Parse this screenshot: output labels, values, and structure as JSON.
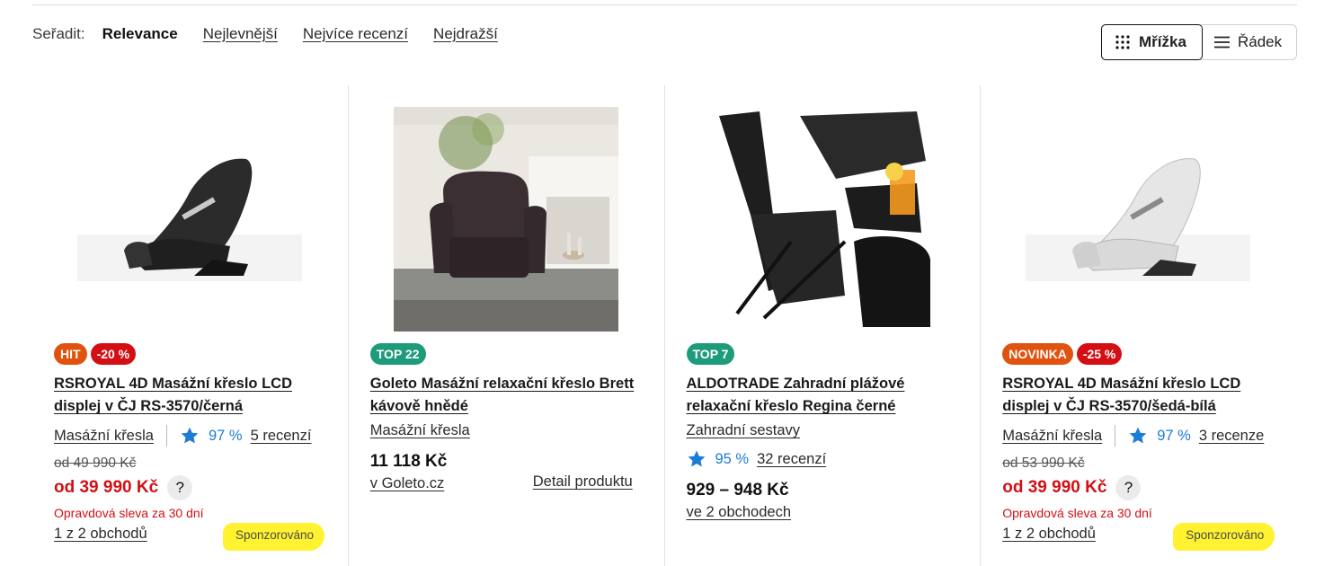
{
  "sort": {
    "label": "Seřadit:",
    "options": [
      "Relevance",
      "Nejlevnější",
      "Nejvíce recenzí",
      "Nejdražší"
    ],
    "active_index": 0
  },
  "view": {
    "grid_label": "Mřížka",
    "row_label": "Řádek",
    "active": "grid"
  },
  "products": [
    {
      "badges": [
        "HIT",
        "-20 %"
      ],
      "title": "RSROYAL 4D Masážní křeslo LCD displej v ČJ RS-3570/černá",
      "category": "Masážní křesla",
      "rating": "97 %",
      "reviews": "5 recenzí",
      "old_price": "od 49 990 Kč",
      "price": "od 39 990 Kč",
      "price_help": "?",
      "discount_note": "Opravdová sleva za 30 dní",
      "shops": "1 z 2 obchodů",
      "sponsored": "Sponzorováno"
    },
    {
      "badges": [
        "TOP 22"
      ],
      "title": "Goleto Masážní relaxační křeslo Brett kávově hnědé",
      "category": "Masážní křesla",
      "price": "11 118 Kč",
      "shop": "v Goleto.cz",
      "detail": "Detail produktu"
    },
    {
      "badges": [
        "TOP 7"
      ],
      "title": "ALDOTRADE Zahradní plážové relaxační křeslo Regina černé",
      "category": "Zahradní sestavy",
      "rating": "95 %",
      "reviews": "32 recenzí",
      "price": "929 – 948 Kč",
      "shops": "ve 2 obchodech"
    },
    {
      "badges": [
        "NOVINKA",
        "-25 %"
      ],
      "title": "RSROYAL 4D Masážní křeslo LCD displej v ČJ RS-3570/šedá-bílá",
      "category": "Masážní křesla",
      "rating": "97 %",
      "reviews": "3 recenze",
      "old_price": "od 53 990 Kč",
      "price": "od 39 990 Kč",
      "price_help": "?",
      "discount_note": "Opravdová sleva za 30 dní",
      "shops": "1 z 2 obchodů",
      "sponsored": "Sponzorováno"
    }
  ],
  "colors": {
    "discount_red": "#d40f14",
    "hit_orange": "#e0520e",
    "top_green": "#1d9b7a",
    "rating_blue": "#1d7bd8",
    "sponsored_highlight": "#fff230"
  },
  "icons": {
    "grid_view": "grid-dots-icon",
    "row_view": "list-lines-icon",
    "rating": "star-icon"
  }
}
